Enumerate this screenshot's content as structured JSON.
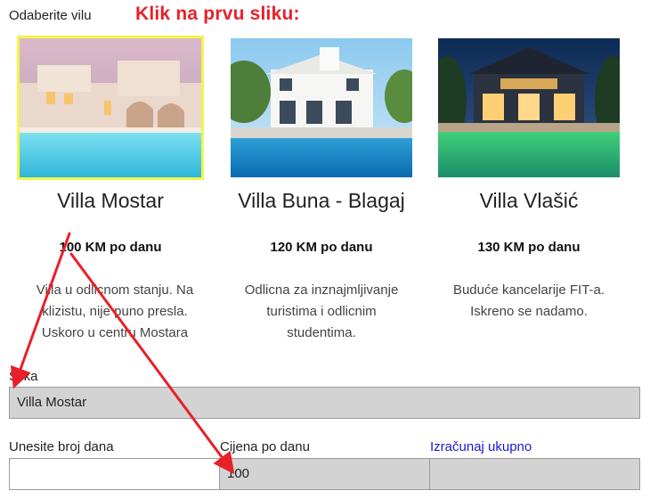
{
  "header": {
    "choose_label": "Odaberite vilu",
    "instruction": "Klik na prvu sliku:"
  },
  "villas": [
    {
      "name": "Villa Mostar",
      "price": "100 KM po danu",
      "desc_lines": [
        "Villa u odlicnom stanju. Na",
        "klizistu, nije puno presla.",
        "Uskoro u centru Mostara"
      ],
      "selected": true
    },
    {
      "name": "Villa Buna - Blagaj",
      "price": "120 KM po danu",
      "desc_lines": [
        "Odlicna za inznajmljivanje",
        "turistima i odlicnim",
        "studentima."
      ],
      "selected": false
    },
    {
      "name": "Villa Vlašić",
      "price": "130 KM po danu",
      "desc_lines": [
        "Buduće kancelarije FIT-a.",
        "Iskreno se nadamo."
      ],
      "selected": false
    }
  ],
  "form": {
    "image_label": "Slika",
    "image_value": "Villa Mostar",
    "days_label": "Unesite broj dana",
    "days_value": "",
    "price_label": "Cijena po danu",
    "price_value": "100",
    "calc_link": "Izračunaj ukupno",
    "total_value": ""
  },
  "colors": {
    "instruction_red": "#e8202a",
    "arrow_red": "#e8202a",
    "selected_border": "#f4f54a",
    "readonly_field_bg": "#d3d3d3",
    "link_blue": "#1a1acc"
  }
}
